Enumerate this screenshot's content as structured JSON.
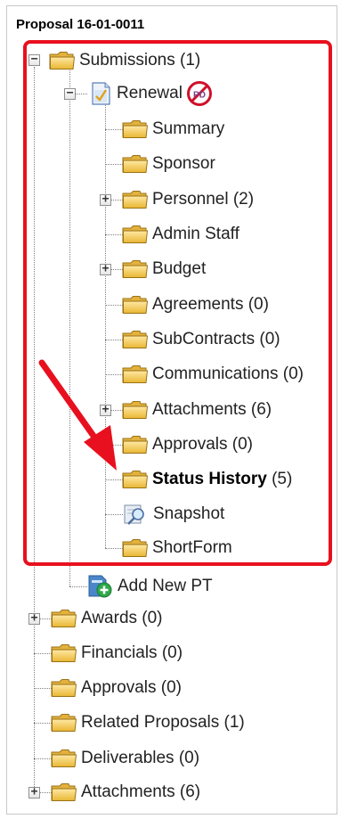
{
  "proposal_title": "Proposal 16-01-0011",
  "tree": {
    "submissions": {
      "label": "Submissions (1)",
      "icon": "folder-open-icon"
    },
    "renewal": {
      "label": "Renewal",
      "icon": "document-check-icon",
      "badge": "PD"
    },
    "renewal_children": [
      {
        "label": "Summary",
        "expandable": false
      },
      {
        "label": "Sponsor",
        "expandable": false
      },
      {
        "label": "Personnel (2)",
        "expandable": true
      },
      {
        "label": "Admin Staff",
        "expandable": false
      },
      {
        "label": "Budget",
        "expandable": true
      },
      {
        "label": "Agreements (0)",
        "expandable": false
      },
      {
        "label": "SubContracts (0)",
        "expandable": false
      },
      {
        "label": "Communications (0)",
        "expandable": false
      },
      {
        "label": "Attachments (6)",
        "expandable": true
      },
      {
        "label": "Approvals (0)",
        "expandable": false
      },
      {
        "label_bold": "Status History",
        "label_rest": " (5)",
        "expandable": false
      },
      {
        "label": "Snapshot",
        "icon": "magnifier-icon",
        "expandable": false
      },
      {
        "label": "ShortForm",
        "expandable": false
      }
    ],
    "add_new_pt": {
      "label": "Add New PT",
      "icon": "add-document-icon"
    },
    "root_items": [
      {
        "label": "Awards (0)",
        "expandable": true
      },
      {
        "label": "Financials (0)",
        "expandable": false
      },
      {
        "label": "Approvals (0)",
        "expandable": false
      },
      {
        "label": "Related Proposals (1)",
        "expandable": false
      },
      {
        "label": "Deliverables (0)",
        "expandable": false
      },
      {
        "label": "Attachments (6)",
        "expandable": true
      }
    ]
  },
  "colors": {
    "highlight": "#e8101e",
    "arrow": "#e8101e",
    "folder": "#f3c84a",
    "connector": "#808080"
  }
}
